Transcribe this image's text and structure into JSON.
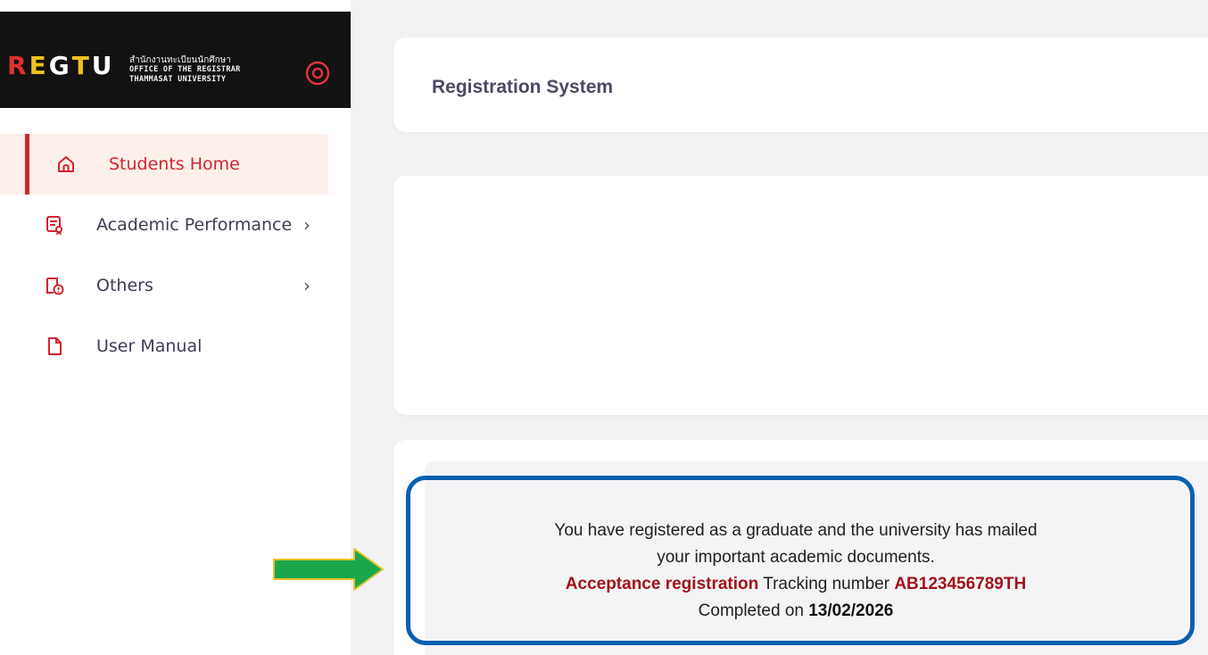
{
  "brand": {
    "logo_text": "REG.TU",
    "thai_name": "สำนักงานทะเบียนนักศึกษา",
    "line1": "OFFICE OF THE REGISTRAR",
    "line2": "THAMMASAT UNIVERSITY",
    "power_icon": "power-icon"
  },
  "sidebar": {
    "items": [
      {
        "label": "Students Home",
        "icon": "home-icon",
        "active": true
      },
      {
        "label": "Academic Performance",
        "icon": "certificate-icon",
        "has_chevron": true
      },
      {
        "label": "Others",
        "icon": "document-alert-icon",
        "has_chevron": true
      },
      {
        "label": "User Manual",
        "icon": "file-icon"
      }
    ]
  },
  "header": {
    "title": "Registration System"
  },
  "notice": {
    "line1": "You have registered as a graduate and the university has mailed",
    "line2": "your important academic documents.",
    "status": "Acceptance registration",
    "tracking_label": "Tracking number",
    "tracking_number": "AB123456789TH",
    "completed_label": "Completed on",
    "completed_date": "13/02/2026"
  },
  "colors": {
    "accent_red": "#d3232f",
    "highlight_border": "#0a5fae",
    "arrow_green": "#1aa64a"
  }
}
